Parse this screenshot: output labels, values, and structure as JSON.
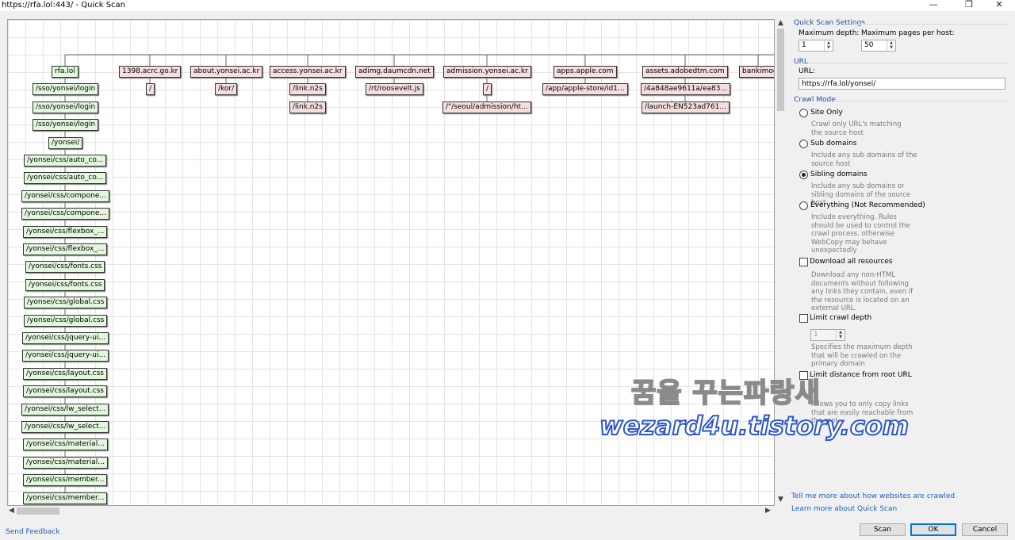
{
  "window": {
    "title": "https://rfa.lol:443/ - Quick Scan",
    "minimize_glyph": "—",
    "restore_glyph": "❐",
    "close_glyph": "✕"
  },
  "tree": {
    "root": "rfa.lol",
    "root_children": [
      "/sso/yonsei/login",
      "/sso/yonsei/login",
      "/sso/yonsei/login",
      "/yonsei/",
      "/yonsei/css/auto_co...",
      "/yonsei/css/auto_co...",
      "/yonsei/css/compone...",
      "/yonsei/css/compone...",
      "/yonsei/css/flexbox_...",
      "/yonsei/css/flexbox_...",
      "/yonsei/css/fonts.css",
      "/yonsei/css/fonts.css",
      "/yonsei/css/global.css",
      "/yonsei/css/global.css",
      "/yonsei/css/jquery-ui...",
      "/yonsei/css/jquery-ui...",
      "/yonsei/css/layout.css",
      "/yonsei/css/layout.css",
      "/yonsei/css/lw_select...",
      "/yonsei/css/lw_select...",
      "/yonsei/css/material...",
      "/yonsei/css/material...",
      "/yonsei/css/member...",
      "/yonsei/css/member..."
    ],
    "hosts": [
      {
        "name": "1398.acrc.go.kr",
        "children": [
          "/"
        ]
      },
      {
        "name": "about.yonsei.ac.kr",
        "children": [
          "/kor/"
        ]
      },
      {
        "name": "access.yonsei.ac.kr",
        "children": [
          "/link.n2s",
          "/link.n2s"
        ]
      },
      {
        "name": "adimg.daumcdn.net",
        "children": [
          "/rt/roosevelt.js"
        ]
      },
      {
        "name": "admission.yonsei.ac.kr",
        "children": [
          "/",
          "/\"/seoul/admission/ht..."
        ]
      },
      {
        "name": "apps.apple.com",
        "children": [
          "/app/apple-store/id1..."
        ]
      },
      {
        "name": "assets.adobedtm.com",
        "children": [
          "/4a848ae9611a/ea83...",
          "/launch-EN523ad761..."
        ]
      },
      {
        "name": "bankimoo",
        "children": []
      }
    ]
  },
  "settings": {
    "section_title": "Quick Scan Settings",
    "max_depth_label": "Maximum depth:",
    "max_depth_value": "1",
    "max_pages_label": "Maximum pages per host:",
    "max_pages_value": "50"
  },
  "url_section": {
    "section_title": "URL",
    "label": "URL:",
    "value": "https://rfa.lol/yonsei/"
  },
  "crawl_mode": {
    "section_title": "Crawl Mode",
    "options": [
      {
        "label": "Site Only",
        "desc": "Crawl only URL's matching the source host",
        "selected": false
      },
      {
        "label": "Sub domains",
        "desc": "Include any sub domains of the source host",
        "selected": false
      },
      {
        "label": "Sibling domains",
        "desc": "Include any sub domains or sibling domains of the source host",
        "selected": true
      },
      {
        "label": "Everything (Not Recommended)",
        "desc": "Include everything. Rules should be used to control the crawl process, otherwise WebCopy may behave unexpectedly",
        "selected": false
      }
    ]
  },
  "options": {
    "download_all_label": "Download all resources",
    "download_all_desc": "Download any non-HTML documents without following any links they contain, even if the resource is located on an external URL.",
    "limit_depth_label": "Limit crawl depth",
    "limit_depth_value": "1",
    "limit_depth_desc": "Specifies the maximum depth that will be crawled on the primary domain",
    "limit_distance_label": "Limit distance from root URL",
    "limit_distance_desc": "Allows you to only copy links that are easily reachable from the root"
  },
  "links": {
    "how_crawled": "Tell me more about how websites are crawled",
    "learn_more": "Learn more about Quick Scan"
  },
  "footer": {
    "send_feedback": "Send Feedback",
    "scan": "Scan",
    "ok": "OK",
    "cancel": "Cancel"
  },
  "watermark": {
    "line1": "꿈을 꾸는파랑새",
    "line2": "wezard4u.tistory.com"
  }
}
